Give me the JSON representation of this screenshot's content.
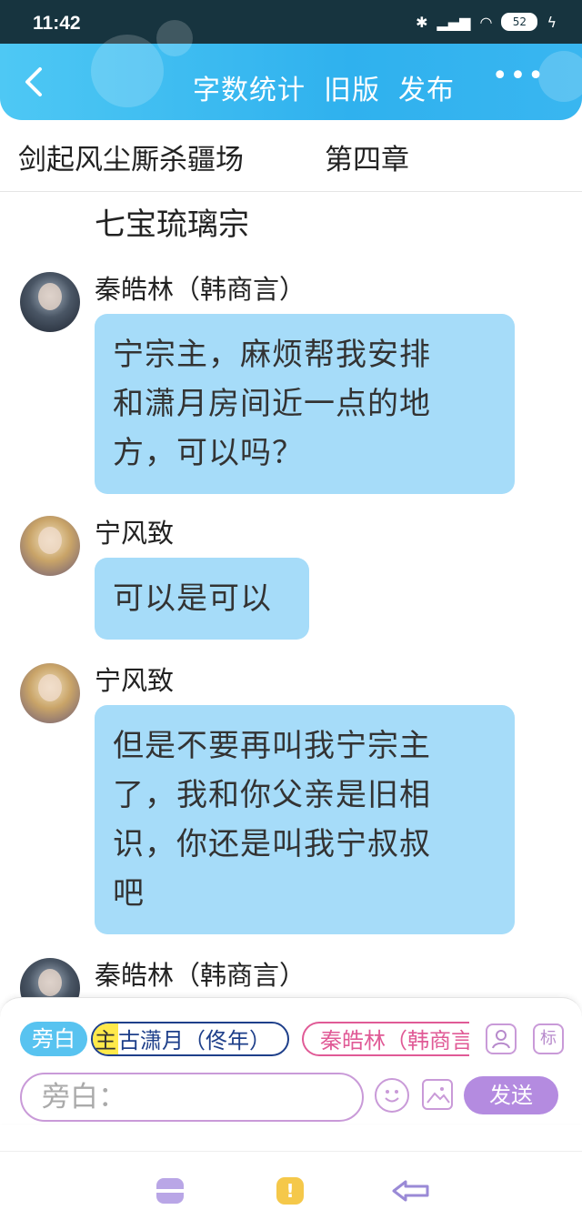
{
  "status_bar": {
    "time": "11:42",
    "battery": "52"
  },
  "header": {
    "actions": [
      "字数统计",
      "旧版",
      "发布"
    ],
    "more": "•••"
  },
  "book": {
    "title": "剑起风尘厮杀疆场",
    "chapter": "第四章"
  },
  "chat": {
    "scene": "七宝琉璃宗",
    "messages": [
      {
        "speaker": "秦皓林（韩商言）",
        "lines": [
          "宁宗主，麻烦帮我安排",
          "和潇月房间近一点的地",
          "方，可以吗？"
        ]
      },
      {
        "speaker": "宁风致",
        "lines": [
          "可以是可以"
        ]
      },
      {
        "speaker": "宁风致",
        "lines": [
          "但是不要再叫我宁宗主",
          "了，我和你父亲是旧相",
          "识，你还是叫我宁叔叔",
          "吧"
        ]
      },
      {
        "speaker": "秦皓林（韩商言）",
        "lines": []
      }
    ]
  },
  "composer": {
    "narration_chip": "旁白",
    "main_mark": "主",
    "main_chip": "古潇月（佟年）",
    "role_chip": "秦皓林（韩商言",
    "tag_icon": "标",
    "placeholder": "旁白：",
    "send_label": "发送"
  },
  "nav": {
    "notice_icon": "!"
  },
  "icons": [
    "back-arrow-icon",
    "more-icon",
    "person-icon",
    "tag-icon",
    "emoji-icon",
    "image-icon",
    "menu-icon",
    "notice-icon",
    "return-icon"
  ],
  "colors": {
    "header": "#2fb1ee",
    "bubble": "#a6dcf9",
    "send": "#b48be0",
    "role_chip": "#e05a96",
    "main_chip": "#1e3f8a"
  }
}
